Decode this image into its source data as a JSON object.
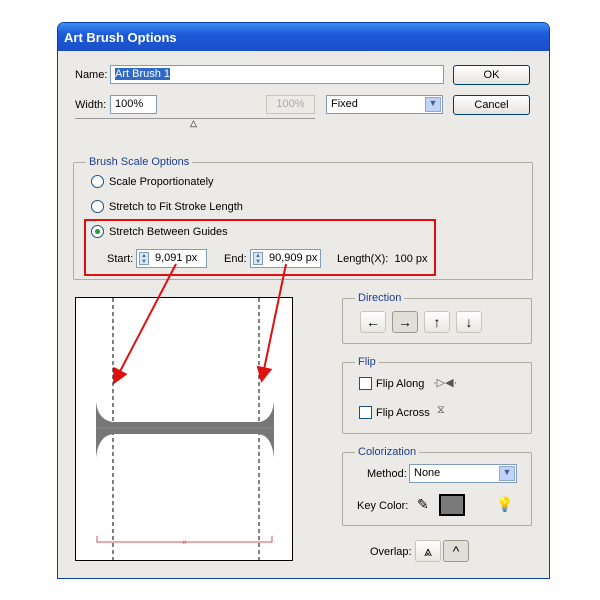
{
  "window": {
    "title": "Art Brush Options"
  },
  "name": {
    "label": "Name:",
    "value": "Art Brush 1"
  },
  "width": {
    "label": "Width:",
    "value": "100%",
    "secondary": "100%",
    "mode": "Fixed",
    "slider_percent": 50
  },
  "buttons": {
    "ok": "OK",
    "cancel": "Cancel"
  },
  "scale": {
    "legend": "Brush Scale Options",
    "options": [
      "Scale Proportionately",
      "Stretch to Fit Stroke Length",
      "Stretch Between Guides"
    ],
    "selected": 2,
    "start_label": "Start:",
    "start_value": "9,091 px",
    "end_label": "End:",
    "end_value": "90,909 px",
    "length": "Length(X):  100 px"
  },
  "direction": {
    "legend": "Direction",
    "buttons": [
      "←",
      "→",
      "↑",
      "↓"
    ],
    "selected": 1
  },
  "flip": {
    "legend": "Flip",
    "along": "Flip Along",
    "across": "Flip Across"
  },
  "colorization": {
    "legend": "Colorization",
    "method_label": "Method:",
    "method": "None",
    "key_label": "Key Color:",
    "key_color": "#7a7a7a"
  },
  "overlap": {
    "label": "Overlap:"
  },
  "colors": {
    "highlight": "#e01010",
    "brush": "#777777"
  }
}
